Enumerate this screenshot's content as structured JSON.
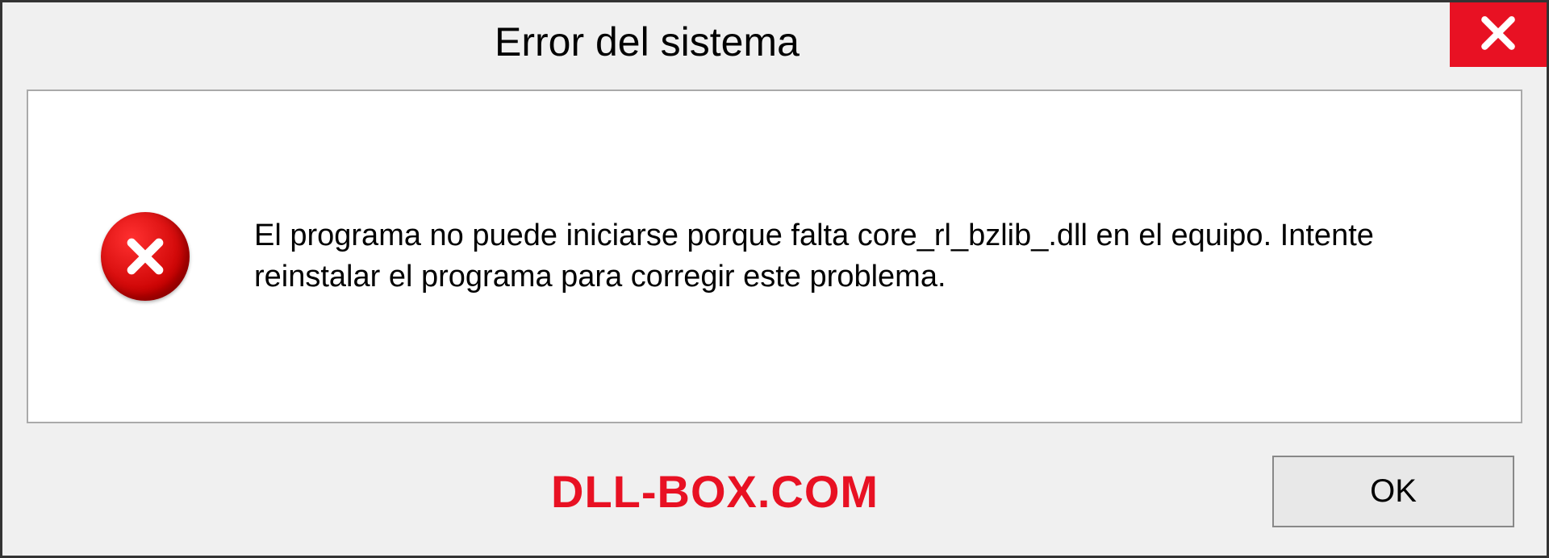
{
  "dialog": {
    "title": "Error del sistema",
    "message": "El programa no puede iniciarse porque falta core_rl_bzlib_.dll en el equipo. Intente reinstalar el programa para corregir este problema.",
    "ok_label": "OK"
  },
  "watermark": "DLL-BOX.COM",
  "colors": {
    "close_bg": "#e81123",
    "error_red": "#d00000",
    "watermark_red": "#e81123"
  }
}
